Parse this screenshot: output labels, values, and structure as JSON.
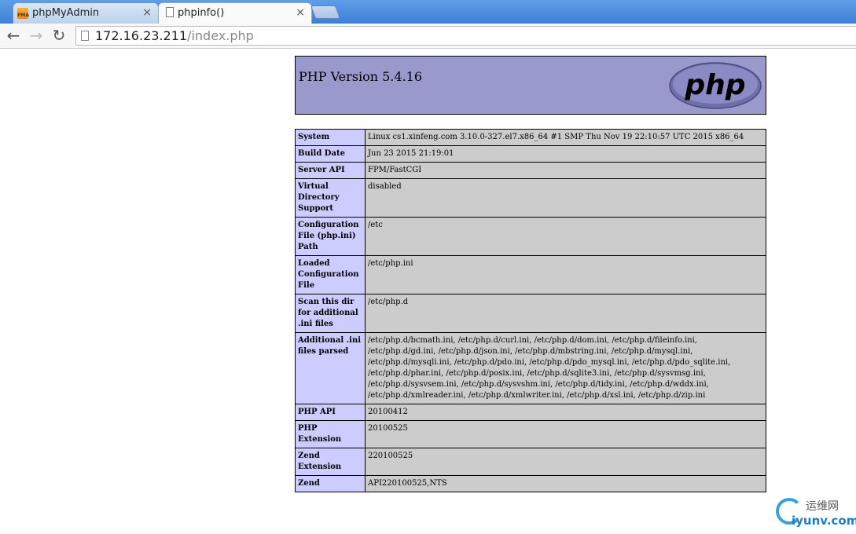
{
  "browser": {
    "tabs": [
      {
        "favicon": "PMA",
        "title": "phpMyAdmin",
        "close": "×"
      },
      {
        "title": "phpinfo()",
        "close": "×"
      }
    ],
    "nav": {
      "back": "←",
      "forward": "→",
      "reload": "↻"
    },
    "address": {
      "host": "172.16.23.211",
      "path": "/index.php"
    }
  },
  "page": {
    "version": "PHP Version 5.4.16",
    "logo_text": "php",
    "rows": [
      {
        "key": "System",
        "value": "Linux cs1.xinfeng.com 3.10.0-327.el7.x86_64 #1 SMP Thu Nov 19 22:10:57 UTC 2015 x86_64"
      },
      {
        "key": "Build Date",
        "value": "Jun 23 2015 21:19:01"
      },
      {
        "key": "Server API",
        "value": "FPM/FastCGI"
      },
      {
        "key": "Virtual Directory Support",
        "value": "disabled"
      },
      {
        "key": "Configuration File (php.ini) Path",
        "value": "/etc"
      },
      {
        "key": "Loaded Configuration File",
        "value": "/etc/php.ini"
      },
      {
        "key": "Scan this dir for additional .ini files",
        "value": "/etc/php.d"
      },
      {
        "key": "Additional .ini files parsed",
        "value": "/etc/php.d/bcmath.ini, /etc/php.d/curl.ini, /etc/php.d/dom.ini, /etc/php.d/fileinfo.ini, /etc/php.d/gd.ini, /etc/php.d/json.ini, /etc/php.d/mbstring.ini, /etc/php.d/mysql.ini, /etc/php.d/mysqli.ini, /etc/php.d/pdo.ini, /etc/php.d/pdo_mysql.ini, /etc/php.d/pdo_sqlite.ini, /etc/php.d/phar.ini, /etc/php.d/posix.ini, /etc/php.d/sqlite3.ini, /etc/php.d/sysvmsg.ini, /etc/php.d/sysvsem.ini, /etc/php.d/sysvshm.ini, /etc/php.d/tidy.ini, /etc/php.d/wddx.ini, /etc/php.d/xmlreader.ini, /etc/php.d/xmlwriter.ini, /etc/php.d/xsl.ini, /etc/php.d/zip.ini"
      },
      {
        "key": "PHP API",
        "value": "20100412"
      },
      {
        "key": "PHP Extension",
        "value": "20100525"
      },
      {
        "key": "Zend Extension",
        "value": "220100525"
      },
      {
        "key": "Zend",
        "value": "API220100525,NTS"
      }
    ]
  },
  "watermark": {
    "cn": "运维网",
    "domain": "iyunv.com"
  },
  "colors": {
    "header_bg": "#9999cc",
    "key_bg": "#ccccff",
    "value_bg": "#cccccc"
  }
}
